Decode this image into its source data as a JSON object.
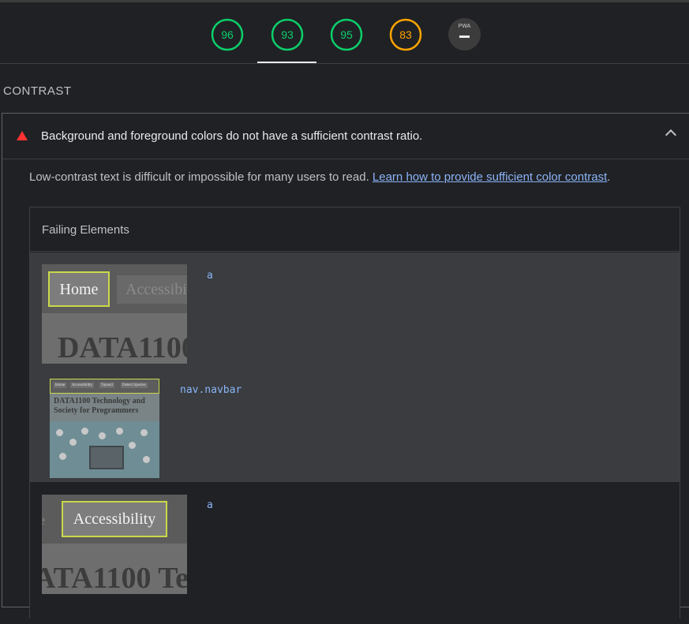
{
  "scores": [
    {
      "value": "96",
      "score": 96,
      "color": "#0cce6b"
    },
    {
      "value": "93",
      "score": 93,
      "color": "#0cce6b"
    },
    {
      "value": "95",
      "score": 95,
      "color": "#0cce6b"
    },
    {
      "value": "83",
      "score": 83,
      "color": "#ffa400"
    }
  ],
  "pwa": {
    "label": "PWA"
  },
  "section": {
    "title": "CONTRAST"
  },
  "audit": {
    "title": "Background and foreground colors do not have a sufficient contrast ratio.",
    "description": "Low-contrast text is difficult or impossible for many users to read.",
    "link_text": "Learn how to provide sufficient color contrast",
    "after_link": ".",
    "table_header": "Failing Elements",
    "items": [
      {
        "node": "a",
        "thumb_highlight": "Home",
        "thumb_next": "Accessibi",
        "thumb_heading": "DATA1100"
      },
      {
        "node": "nav.navbar",
        "thumb_nav": [
          "Home",
          "Accessibility",
          "Topsoil",
          "Detect Species"
        ],
        "thumb_heading": "DATA1100 Technology and Society for Programmers"
      },
      {
        "node": "a",
        "thumb_highlight": "Accessibility",
        "thumb_prev": "e",
        "thumb_heading": "ATA1100 Te"
      }
    ]
  },
  "icons": {
    "fail": "warning-triangle-icon",
    "collapse": "chevron-up-icon"
  }
}
